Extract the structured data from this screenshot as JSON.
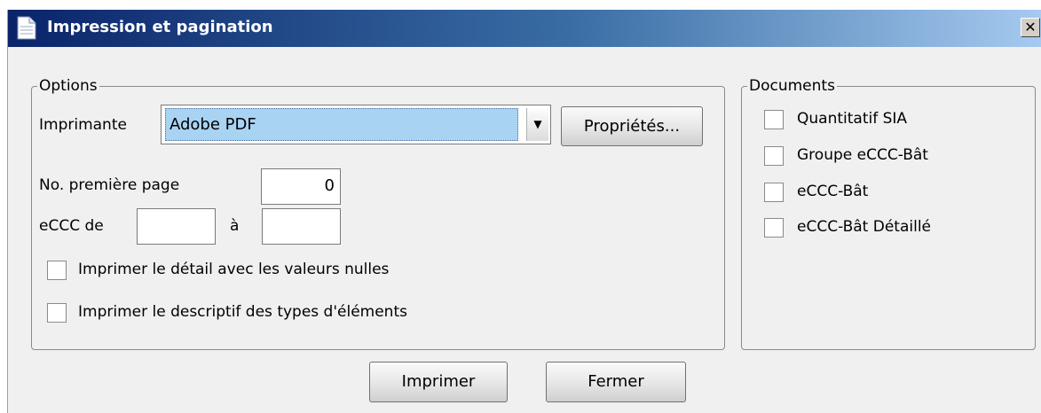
{
  "window": {
    "title": "Impression et pagination",
    "close_glyph": "✕"
  },
  "options": {
    "legend": "Options",
    "printer_label": "Imprimante",
    "printer_value": "Adobe PDF",
    "properties_button": "Propriétés...",
    "first_page_label": "No. première page",
    "first_page_value": "0",
    "eccc_from_label": "eCCC de",
    "eccc_from_value": "",
    "eccc_to_label": "à",
    "eccc_to_value": "",
    "checkboxes": [
      {
        "label": "Imprimer le détail avec les valeurs nulles",
        "checked": false
      },
      {
        "label": "Imprimer le descriptif des types d'éléments",
        "checked": false
      }
    ]
  },
  "documents": {
    "legend": "Documents",
    "items": [
      {
        "label": "Quantitatif SIA",
        "checked": false
      },
      {
        "label": "Groupe eCCC-Bât",
        "checked": false
      },
      {
        "label": "eCCC-Bât",
        "checked": false
      },
      {
        "label": "eCCC-Bât Détaillé",
        "checked": false
      }
    ]
  },
  "buttons": {
    "print": "Imprimer",
    "close": "Fermer"
  },
  "colors": {
    "title_gradient_start": "#0a246a",
    "title_gradient_end": "#a6caf0",
    "selection_highlight": "#a9d3f2",
    "window_background": "#f0f0f0"
  },
  "icons": {
    "title": "document-icon",
    "dropdown": "chevron-down-icon"
  }
}
